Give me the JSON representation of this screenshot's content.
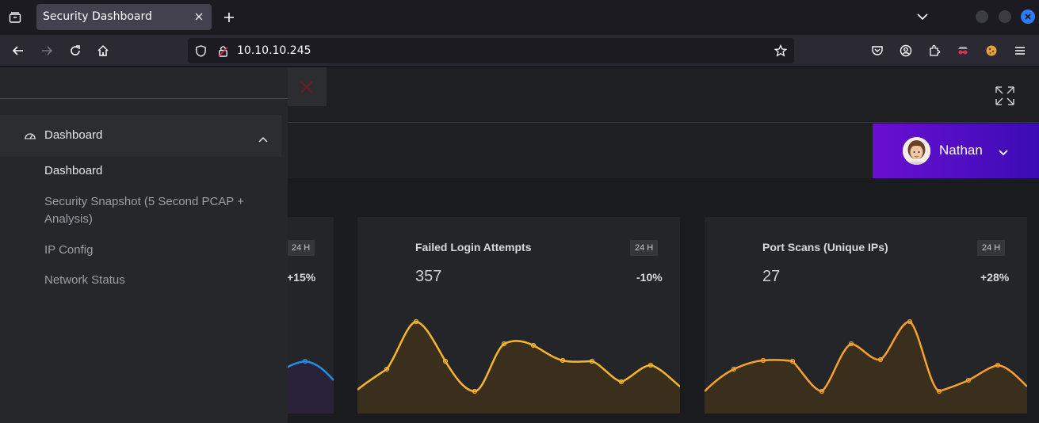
{
  "browser": {
    "tab_title": "Security Dashboard",
    "url": "10.10.10.245"
  },
  "header": {
    "user_name": "Nathan"
  },
  "sidebar": {
    "group_label": "Dashboard",
    "items": [
      {
        "label": "Dashboard"
      },
      {
        "label": "Security Snapshot (5 Second PCAP + Analysis)"
      },
      {
        "label": "IP Config"
      },
      {
        "label": "Network Status"
      }
    ]
  },
  "cards": [
    {
      "title": "",
      "badge": "24 H",
      "value": "",
      "delta": "+15%",
      "color": "#1f8fe5"
    },
    {
      "title": "Failed Login Attempts",
      "badge": "24 H",
      "value": "357",
      "delta": "-10%",
      "color": "#f5b628"
    },
    {
      "title": "Port Scans (Unique IPs)",
      "badge": "24 H",
      "value": "27",
      "delta": "+28%",
      "color": "#f7a22c"
    }
  ],
  "colors": {
    "accent_purple": "#6a0fd1",
    "spark_yellow": "#f5b628",
    "spark_orange": "#f7a22c",
    "spark_blue": "#1f8fe5"
  }
}
